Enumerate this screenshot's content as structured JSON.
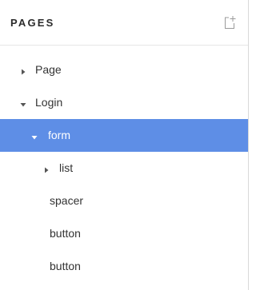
{
  "panel": {
    "title": "PAGES",
    "add_icon": "add-page-icon"
  },
  "tree": {
    "items": [
      {
        "label": "Page",
        "caret": "collapsed",
        "depth": 0,
        "selected": false
      },
      {
        "label": "Login",
        "caret": "expanded",
        "depth": 0,
        "selected": false
      },
      {
        "label": "form",
        "caret": "expanded",
        "depth": 1,
        "selected": true
      },
      {
        "label": "list",
        "caret": "collapsed",
        "depth": 2,
        "selected": false
      },
      {
        "label": "spacer",
        "caret": "none",
        "depth": 2,
        "selected": false
      },
      {
        "label": "button",
        "caret": "none",
        "depth": 2,
        "selected": false
      },
      {
        "label": "button",
        "caret": "none",
        "depth": 2,
        "selected": false
      }
    ]
  },
  "colors": {
    "selection": "#5e8ee6",
    "text": "#333333",
    "icon": "#999999"
  }
}
